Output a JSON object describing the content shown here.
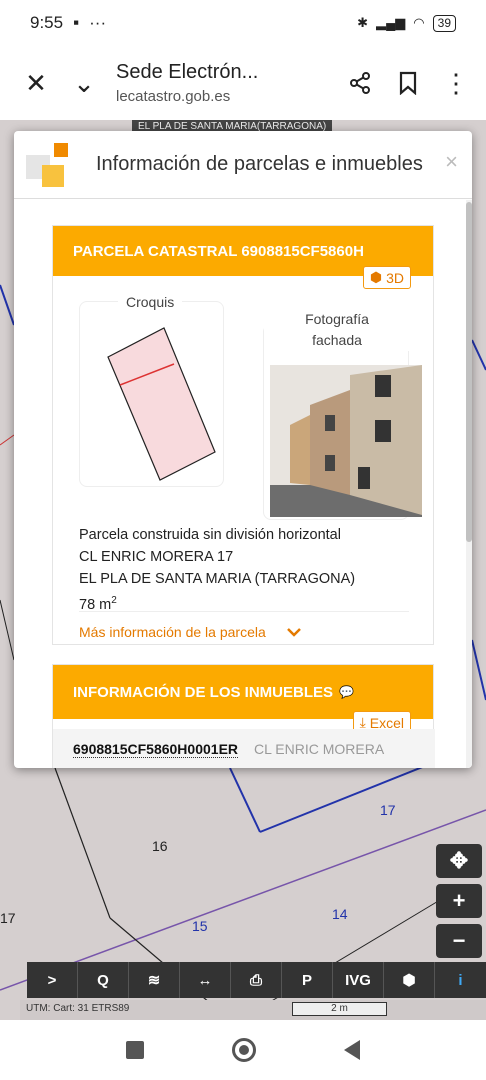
{
  "status": {
    "time": "9:55",
    "battery": "39"
  },
  "browser": {
    "site_title": "Sede Electrón...",
    "site_url": "lecatastro.gob.es"
  },
  "map": {
    "place_label": "EL PLA DE SANTA MARIA(TARRAGONA)",
    "parcel_numbers": [
      "17",
      "16",
      "17",
      "15",
      "14"
    ],
    "scale_text": "UTM: Cart: 31 ETRS89",
    "scale_value": "2 m"
  },
  "modal": {
    "title": "Información de parcelas e inmuebles",
    "close": "×"
  },
  "parcel": {
    "header": "PARCELA CATASTRAL 6908815CF5860H",
    "btn_3d": "3D",
    "croquis_label": "Croquis",
    "foto_label_1": "Fotografía",
    "foto_label_2": "fachada",
    "description": "Parcela construida sin división horizontal",
    "address": "CL ENRIC MORERA 17",
    "municipality": "EL PLA DE SANTA MARIA (TARRAGONA)",
    "area": "78 m",
    "area_sup": "2",
    "more_info": "Más información de la parcela"
  },
  "inmuebles": {
    "header": "INFORMACIÓN DE LOS INMUEBLES",
    "btn_excel": "Excel",
    "rows": [
      {
        "ref": "6908815CF5860H0001ER",
        "address": "CL ENRIC MORERA"
      }
    ]
  },
  "toolbar": {
    "labels": [
      ">",
      "Q",
      "≋",
      "↔",
      "⎙",
      "P",
      "IVG",
      "⬢",
      "i"
    ]
  },
  "colors": {
    "accent": "#fcaa00",
    "link": "#e47a00"
  }
}
